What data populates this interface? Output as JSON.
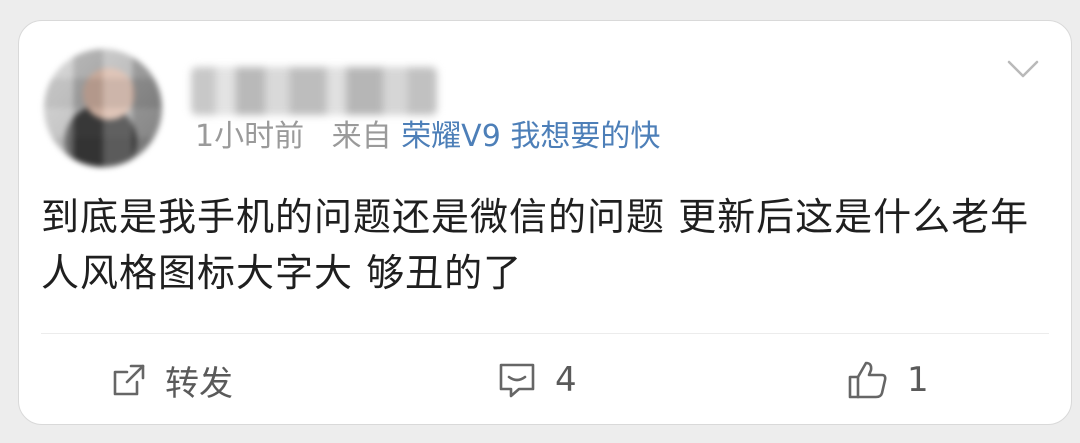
{
  "post": {
    "time": "1小时前",
    "from_label": "来自",
    "source": "荣耀V9 我想要的快",
    "content": "到底是我手机的问题还是微信的问题 更新后这是什么老年人风格图标大字大 够丑的了"
  },
  "actions": {
    "repost_label": "转发",
    "comment_count": "4",
    "like_count": "1"
  },
  "colors": {
    "link": "#4d7fb8",
    "meta": "#9a9a9a",
    "text": "#1f1f1f",
    "card": "#ffffff",
    "page": "#ededed"
  },
  "icons": {
    "menu": "chevron-down-icon",
    "repost": "share-icon",
    "comment": "comment-icon",
    "like": "thumbs-up-icon"
  }
}
